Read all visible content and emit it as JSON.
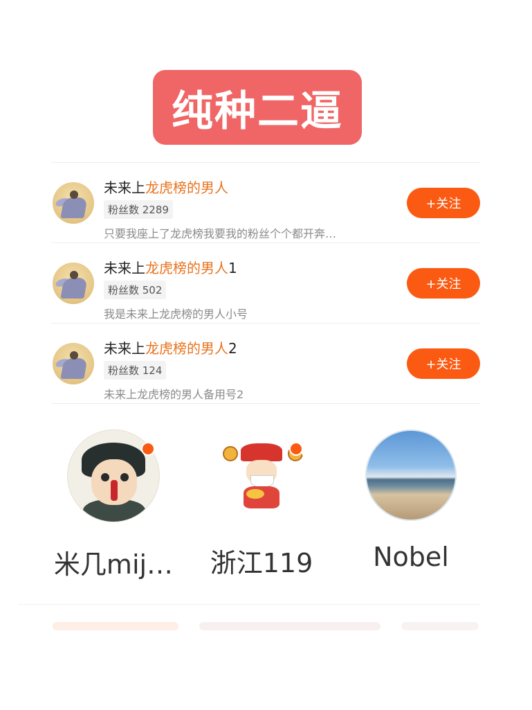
{
  "banner": {
    "text": "纯种二逼"
  },
  "results": [
    {
      "name_prefix": "未来上",
      "name_highlight": "龙虎榜的男人",
      "name_suffix": "",
      "fans": "粉丝数 2289",
      "desc": "只要我座上了龙虎榜我要我的粉丝个个都开奔…",
      "follow_label": "+关注"
    },
    {
      "name_prefix": "未来上",
      "name_highlight": "龙虎榜的男人",
      "name_suffix": "1",
      "fans": "粉丝数 502",
      "desc": "我是未来上龙虎榜的男人小号",
      "follow_label": "+关注"
    },
    {
      "name_prefix": "未来上",
      "name_highlight": "龙虎榜的男人",
      "name_suffix": "2",
      "fans": "粉丝数 124",
      "desc": "未来上龙虎榜的男人备用号2",
      "follow_label": "+关注"
    }
  ],
  "users": [
    {
      "name": "米几mij…",
      "avatar": "cartoon-man-avatar",
      "has_dot": true
    },
    {
      "name": "浙江119",
      "avatar": "god-of-wealth-avatar",
      "has_dot": true
    },
    {
      "name": "Nobel",
      "avatar": "beach-landscape-avatar",
      "has_dot": false
    }
  ],
  "colors": {
    "accent": "#fb5a12",
    "highlight": "#e8731f",
    "banner": "#f06565"
  }
}
